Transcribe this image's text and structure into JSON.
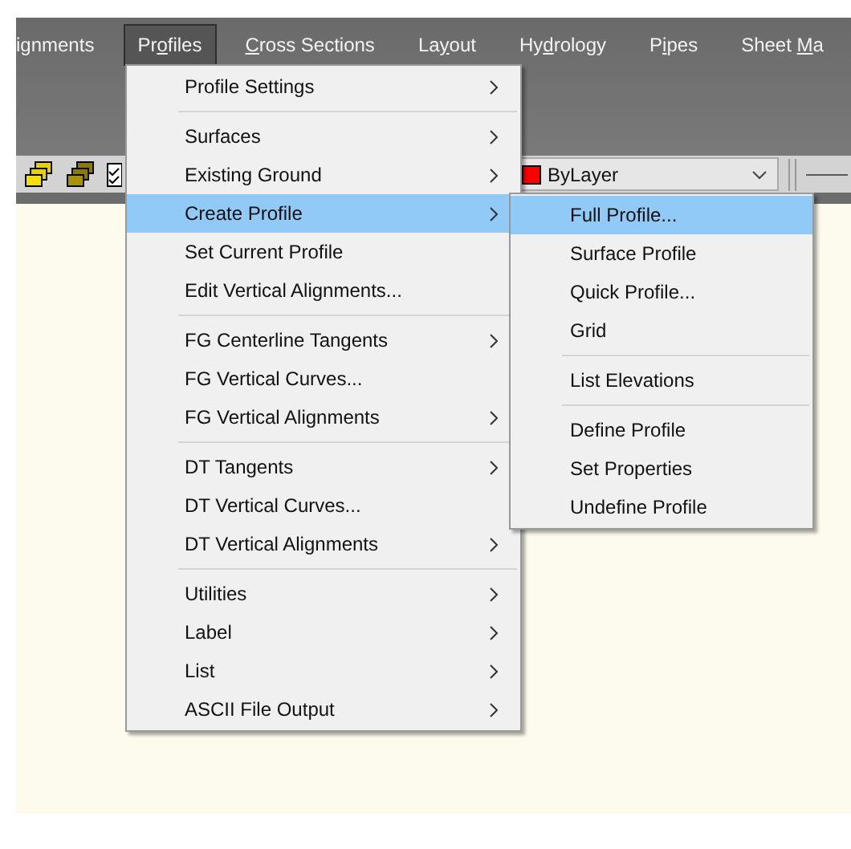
{
  "menubar": [
    {
      "post": "ignments",
      "selected": false
    },
    {
      "pre": "Pr",
      "key": "o",
      "post": "files",
      "selected": true
    },
    {
      "key": "C",
      "post": "ross Sections",
      "selected": false
    },
    {
      "pre": "La",
      "key": "y",
      "post": "out",
      "selected": false
    },
    {
      "pre": "Hy",
      "key": "d",
      "post": "rology",
      "selected": false
    },
    {
      "pre": "P",
      "key": "i",
      "post": "pes",
      "selected": false
    },
    {
      "pre": "Sheet ",
      "key": "M",
      "post": "a",
      "selected": false
    }
  ],
  "toolbar": {
    "color_dropdown": {
      "value": "ByLayer",
      "color": "#ff0000"
    }
  },
  "menu": [
    {
      "kind": "item",
      "label": "Profile Settings",
      "submenu": true,
      "selected": false
    },
    {
      "kind": "separator"
    },
    {
      "kind": "item",
      "label": "Surfaces",
      "submenu": true,
      "selected": false
    },
    {
      "kind": "item",
      "label": "Existing Ground",
      "submenu": true,
      "selected": false
    },
    {
      "kind": "item",
      "label": "Create Profile",
      "submenu": true,
      "selected": true
    },
    {
      "kind": "item",
      "label": "Set Current Profile",
      "submenu": false,
      "selected": false
    },
    {
      "kind": "item",
      "label": "Edit Vertical Alignments...",
      "submenu": false,
      "selected": false
    },
    {
      "kind": "separator"
    },
    {
      "kind": "item",
      "label": "FG Centerline Tangents",
      "submenu": true,
      "selected": false
    },
    {
      "kind": "item",
      "label": "FG Vertical Curves...",
      "submenu": false,
      "selected": false
    },
    {
      "kind": "item",
      "label": "FG Vertical Alignments",
      "submenu": true,
      "selected": false
    },
    {
      "kind": "separator"
    },
    {
      "kind": "item",
      "label": "DT Tangents",
      "submenu": true,
      "selected": false
    },
    {
      "kind": "item",
      "label": "DT Vertical Curves...",
      "submenu": false,
      "selected": false
    },
    {
      "kind": "item",
      "label": "DT Vertical Alignments",
      "submenu": true,
      "selected": false
    },
    {
      "kind": "separator"
    },
    {
      "kind": "item",
      "label": "Utilities",
      "submenu": true,
      "selected": false
    },
    {
      "kind": "item",
      "label": "Label",
      "submenu": true,
      "selected": false
    },
    {
      "kind": "item",
      "label": "List",
      "submenu": true,
      "selected": false
    },
    {
      "kind": "item",
      "label": "ASCII File Output",
      "submenu": true,
      "selected": false
    }
  ],
  "submenu": [
    {
      "kind": "item",
      "label": "Full Profile...",
      "selected": true
    },
    {
      "kind": "item",
      "label": "Surface Profile",
      "selected": false
    },
    {
      "kind": "item",
      "label": "Quick Profile...",
      "selected": false
    },
    {
      "kind": "item",
      "label": "Grid",
      "selected": false
    },
    {
      "kind": "separator"
    },
    {
      "kind": "item",
      "label": "List Elevations",
      "selected": false
    },
    {
      "kind": "separator"
    },
    {
      "kind": "item",
      "label": "Define Profile",
      "selected": false
    },
    {
      "kind": "item",
      "label": "Set Properties",
      "selected": false
    },
    {
      "kind": "item",
      "label": "Undefine Profile",
      "selected": false
    }
  ]
}
